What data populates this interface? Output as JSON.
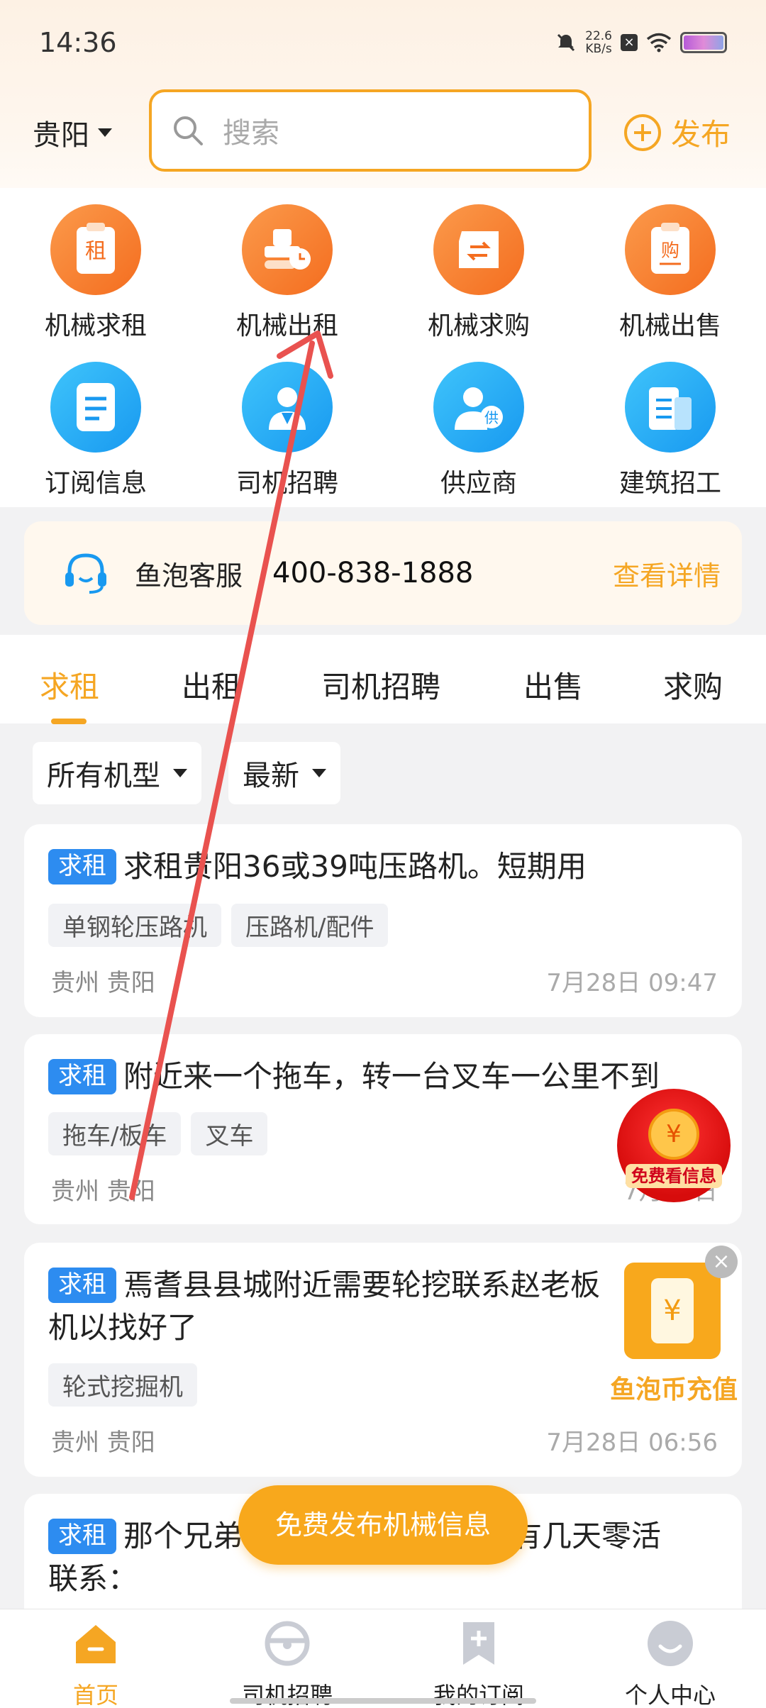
{
  "status": {
    "time": "14:36",
    "speed_num": "22.6",
    "speed_unit": "KB/s"
  },
  "header": {
    "city": "贵阳",
    "search_placeholder": "搜索",
    "publish_label": "发布"
  },
  "grid": [
    {
      "label": "机械求租",
      "icon": "rent-request-icon",
      "glyph": "租"
    },
    {
      "label": "机械出租",
      "icon": "excavator-rent-icon",
      "glyph": ""
    },
    {
      "label": "机械求购",
      "icon": "buy-request-icon",
      "glyph": ""
    },
    {
      "label": "机械出售",
      "icon": "sell-icon",
      "glyph": "购"
    },
    {
      "label": "订阅信息",
      "icon": "subscription-icon",
      "glyph": ""
    },
    {
      "label": "司机招聘",
      "icon": "driver-icon",
      "glyph": ""
    },
    {
      "label": "供应商",
      "icon": "supplier-icon",
      "glyph": "供"
    },
    {
      "label": "建筑招工",
      "icon": "building-icon",
      "glyph": ""
    }
  ],
  "service": {
    "label": "鱼泡客服",
    "phone": "400-838-1888",
    "more": "查看详情"
  },
  "tabs": [
    "求租",
    "出租",
    "司机招聘",
    "出售",
    "求购"
  ],
  "filters": {
    "type": "所有机型",
    "sort": "最新"
  },
  "listings": [
    {
      "badge": "求租",
      "title": "求租贵阳36或39吨压路机。短期用",
      "tags": [
        "单钢轮压路机",
        "压路机/配件"
      ],
      "location": "贵州 贵阳",
      "time": "7月28日 09:47"
    },
    {
      "badge": "求租",
      "title": "附近来一个拖车，转一台叉车一公里不到",
      "tags": [
        "拖车/板车",
        "叉车"
      ],
      "location": "贵州 贵阳",
      "time": "7月28日"
    },
    {
      "badge": "求租",
      "title": "焉耆县县城附近需要轮挖联系赵老板",
      "title2": "机以找好了",
      "tags": [
        "轮式挖掘机"
      ],
      "location": "贵州 贵阳",
      "time": "7月28日 06:56"
    },
    {
      "badge": "求租",
      "title": "那个兄弟",
      "title_tail": "有几天零活",
      "title2": "联系："
    }
  ],
  "floating": {
    "free_view": "免费看信息",
    "coin_glyph": "¥",
    "recharge": "鱼泡币充值",
    "fab": "免费发布机械信息"
  },
  "bottom_nav": [
    "首页",
    "司机招聘",
    "我的订阅",
    "个人中心"
  ],
  "colors": {
    "accent": "#f5a623",
    "badge_blue": "#2d8cf0",
    "orange_icon": "#f46d1f",
    "blue_icon": "#1899f0",
    "annotation_arrow": "#e9524f"
  }
}
